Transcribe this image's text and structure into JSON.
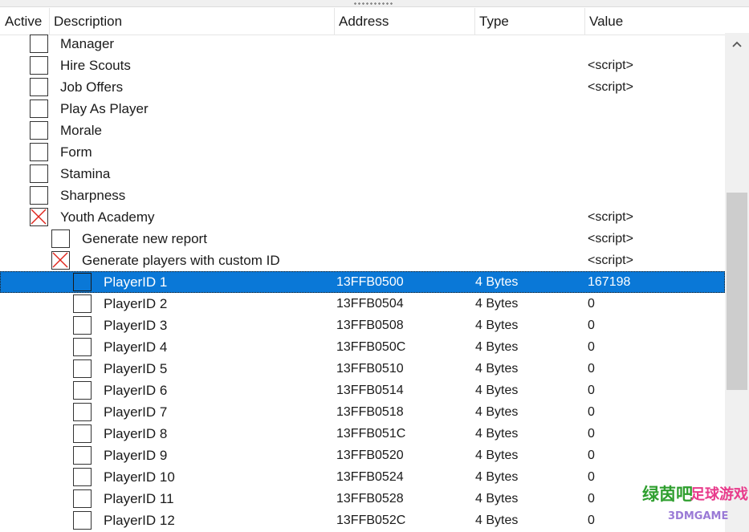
{
  "columns": {
    "active": "Active",
    "description": "Description",
    "address": "Address",
    "type": "Type",
    "value": "Value"
  },
  "rows": [
    {
      "description": "Manager",
      "address": "",
      "type": "",
      "value": "",
      "checked": false,
      "indent": 0
    },
    {
      "description": "Hire Scouts",
      "address": "",
      "type": "",
      "value": "<script>",
      "checked": false,
      "indent": 0
    },
    {
      "description": "Job Offers",
      "address": "",
      "type": "",
      "value": "<script>",
      "checked": false,
      "indent": 0
    },
    {
      "description": "Play As Player",
      "address": "",
      "type": "",
      "value": "",
      "checked": false,
      "indent": 0
    },
    {
      "description": "Morale",
      "address": "",
      "type": "",
      "value": "",
      "checked": false,
      "indent": 0
    },
    {
      "description": "Form",
      "address": "",
      "type": "",
      "value": "",
      "checked": false,
      "indent": 0
    },
    {
      "description": "Stamina",
      "address": "",
      "type": "",
      "value": "",
      "checked": false,
      "indent": 0
    },
    {
      "description": "Sharpness",
      "address": "",
      "type": "",
      "value": "",
      "checked": false,
      "indent": 0
    },
    {
      "description": "Youth Academy",
      "address": "",
      "type": "",
      "value": "<script>",
      "checked": true,
      "indent": 0
    },
    {
      "description": "Generate new report",
      "address": "",
      "type": "",
      "value": "<script>",
      "checked": false,
      "indent": 1
    },
    {
      "description": "Generate players with custom ID",
      "address": "",
      "type": "",
      "value": "<script>",
      "checked": true,
      "indent": 1
    },
    {
      "description": "PlayerID 1",
      "address": "13FFB0500",
      "type": "4 Bytes",
      "value": "167198",
      "checked": false,
      "indent": 2,
      "selected": true
    },
    {
      "description": "PlayerID 2",
      "address": "13FFB0504",
      "type": "4 Bytes",
      "value": "0",
      "checked": false,
      "indent": 2
    },
    {
      "description": "PlayerID 3",
      "address": "13FFB0508",
      "type": "4 Bytes",
      "value": "0",
      "checked": false,
      "indent": 2
    },
    {
      "description": "PlayerID 4",
      "address": "13FFB050C",
      "type": "4 Bytes",
      "value": "0",
      "checked": false,
      "indent": 2
    },
    {
      "description": "PlayerID 5",
      "address": "13FFB0510",
      "type": "4 Bytes",
      "value": "0",
      "checked": false,
      "indent": 2
    },
    {
      "description": "PlayerID 6",
      "address": "13FFB0514",
      "type": "4 Bytes",
      "value": "0",
      "checked": false,
      "indent": 2
    },
    {
      "description": "PlayerID 7",
      "address": "13FFB0518",
      "type": "4 Bytes",
      "value": "0",
      "checked": false,
      "indent": 2
    },
    {
      "description": "PlayerID 8",
      "address": "13FFB051C",
      "type": "4 Bytes",
      "value": "0",
      "checked": false,
      "indent": 2
    },
    {
      "description": "PlayerID 9",
      "address": "13FFB0520",
      "type": "4 Bytes",
      "value": "0",
      "checked": false,
      "indent": 2
    },
    {
      "description": "PlayerID 10",
      "address": "13FFB0524",
      "type": "4 Bytes",
      "value": "0",
      "checked": false,
      "indent": 2
    },
    {
      "description": "PlayerID 11",
      "address": "13FFB0528",
      "type": "4 Bytes",
      "value": "0",
      "checked": false,
      "indent": 2
    },
    {
      "description": "PlayerID 12",
      "address": "13FFB052C",
      "type": "4 Bytes",
      "value": "0",
      "checked": false,
      "indent": 2
    }
  ],
  "scrollbar": {
    "up_icon": "chevron-up-icon"
  },
  "watermark": {
    "line1": "绿茵吧",
    "line2": "足球游戏网",
    "line3": "3DMGAME"
  },
  "colors": {
    "selection": "#0a78d7",
    "check_x": "#e0241b"
  }
}
